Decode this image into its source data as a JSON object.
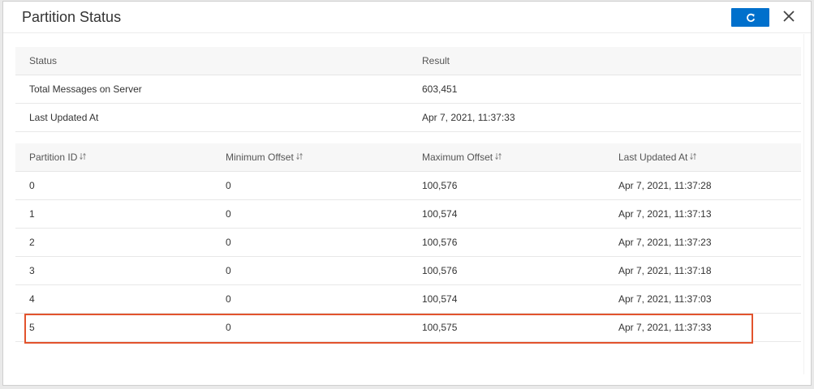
{
  "dialog": {
    "title": "Partition Status",
    "refresh_icon": "refresh-icon",
    "close_icon": "close-icon",
    "accent_color": "#0070cc",
    "highlight_color": "#e2532d"
  },
  "summary": {
    "headers": [
      "Status",
      "Result"
    ],
    "rows": [
      {
        "label": "Total Messages on Server",
        "value": "603,451"
      },
      {
        "label": "Last Updated At",
        "value": "Apr 7, 2021, 11:37:33"
      }
    ]
  },
  "partitions": {
    "headers": [
      "Partition ID",
      "Minimum Offset",
      "Maximum Offset",
      "Last Updated At"
    ],
    "sort_icon": "sort-icon",
    "rows": [
      {
        "id": "0",
        "min": "0",
        "max": "100,576",
        "updated": "Apr 7, 2021, 11:37:28"
      },
      {
        "id": "1",
        "min": "0",
        "max": "100,574",
        "updated": "Apr 7, 2021, 11:37:13"
      },
      {
        "id": "2",
        "min": "0",
        "max": "100,576",
        "updated": "Apr 7, 2021, 11:37:23"
      },
      {
        "id": "3",
        "min": "0",
        "max": "100,576",
        "updated": "Apr 7, 2021, 11:37:18"
      },
      {
        "id": "4",
        "min": "0",
        "max": "100,574",
        "updated": "Apr 7, 2021, 11:37:03"
      },
      {
        "id": "5",
        "min": "0",
        "max": "100,575",
        "updated": "Apr 7, 2021, 11:37:33"
      }
    ],
    "highlighted_row_id": "5"
  }
}
